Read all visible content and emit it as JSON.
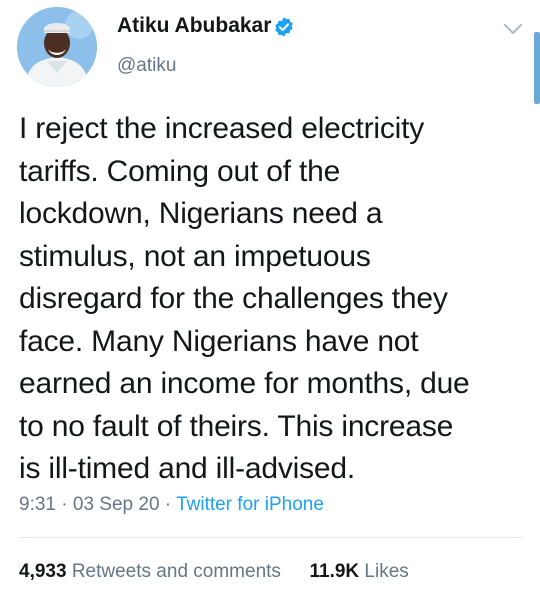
{
  "user": {
    "display_name": "Atiku Abubakar",
    "handle": "@atiku",
    "verified": true
  },
  "tweet": {
    "text": "I reject the increased electricity\ntariffs. Coming out of the\nlockdown, Nigerians need a\nstimulus, not an impetuous\ndisregard for the challenges they\nface. Many Nigerians have not\nearned an income for months, due\nto no fault of theirs. This increase\nis ill-timed and ill-advised.",
    "time": "9:31",
    "separator": "·",
    "date": "03 Sep 20",
    "source": "Twitter for iPhone"
  },
  "stats": {
    "retweets_count": "4,933",
    "retweets_label": "Retweets and comments",
    "likes_count": "11.9K",
    "likes_label": "Likes"
  },
  "icons": {
    "verified": "verified-badge-icon",
    "more": "chevron-down-icon"
  },
  "colors": {
    "brand": "#1da1f2",
    "secondary_text": "#657786",
    "primary_text": "#14171a",
    "divider": "#e1e8ed"
  }
}
